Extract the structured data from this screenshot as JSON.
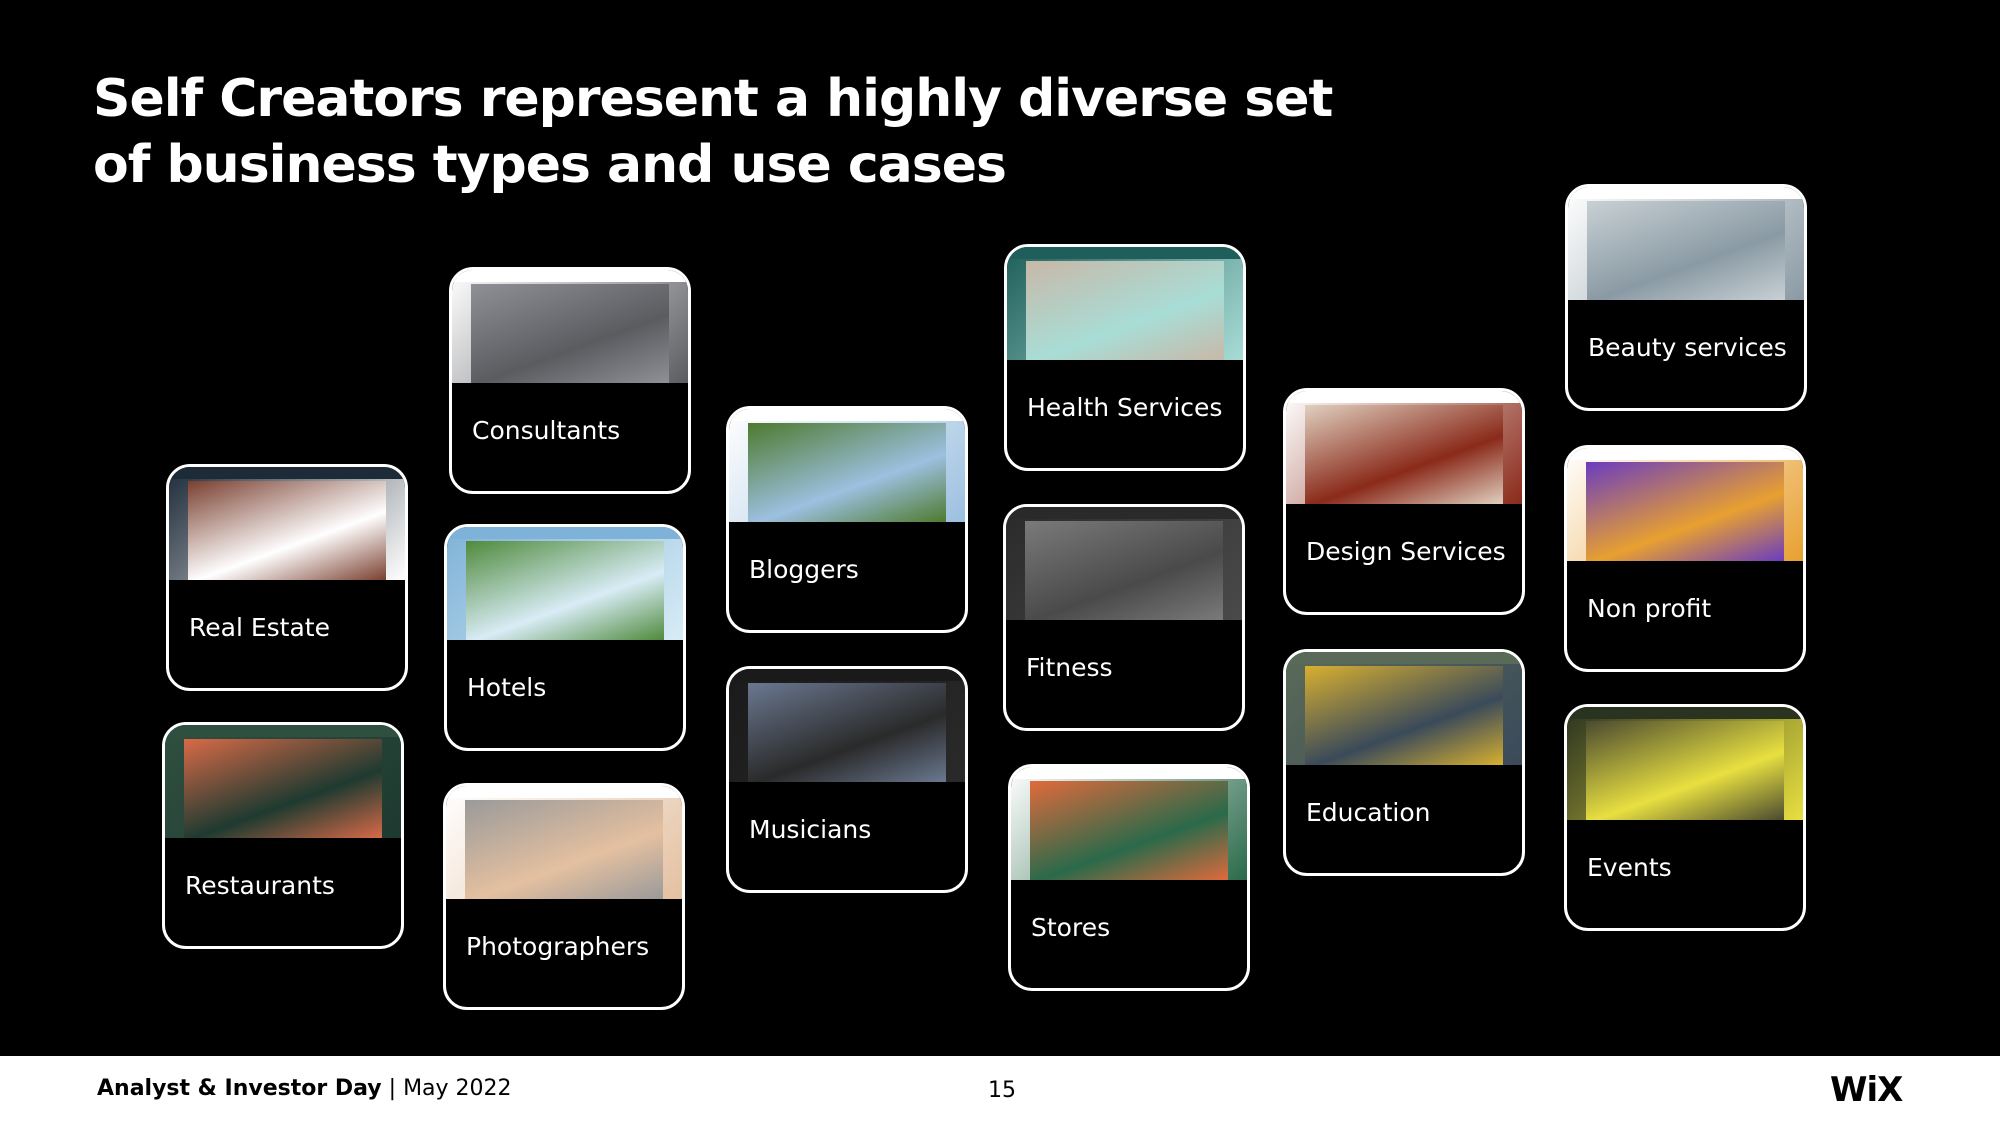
{
  "slide": {
    "title": "Self Creators represent a highly diverse set of business types and use cases"
  },
  "cards": [
    {
      "label": "Real Estate",
      "thumb_colors": [
        "#1d2a38",
        "#7a4030",
        "#ffffff"
      ]
    },
    {
      "label": "Restaurants",
      "thumb_colors": [
        "#2f4f40",
        "#d86a48",
        "#1e3a30"
      ]
    },
    {
      "label": "Consultants",
      "thumb_colors": [
        "#ffffff",
        "#8e9096",
        "#5a5c60"
      ]
    },
    {
      "label": "Hotels",
      "thumb_colors": [
        "#7fb2d8",
        "#4f8a3c",
        "#d8ecf6"
      ]
    },
    {
      "label": "Photographers",
      "thumb_colors": [
        "#ffffff",
        "#9a9a9a",
        "#e4c0a0"
      ]
    },
    {
      "label": "Bloggers",
      "thumb_colors": [
        "#ffffff",
        "#4e7a2e",
        "#9cc0e0"
      ]
    },
    {
      "label": "Musicians",
      "thumb_colors": [
        "#1a1a1a",
        "#6a7890",
        "#2a2a2a"
      ]
    },
    {
      "label": "Health Services",
      "thumb_colors": [
        "#1f5e5a",
        "#c8b8a8",
        "#a8ddd6"
      ]
    },
    {
      "label": "Fitness",
      "thumb_colors": [
        "#2a2a2a",
        "#7a7a7a",
        "#4a4a4a"
      ]
    },
    {
      "label": "Stores",
      "thumb_colors": [
        "#ffffff",
        "#e06a3c",
        "#2a6a4a"
      ]
    },
    {
      "label": "Design Services",
      "thumb_colors": [
        "#ffffff",
        "#e0d0c0",
        "#8a2a1a"
      ]
    },
    {
      "label": "Education",
      "thumb_colors": [
        "#5a6a58",
        "#d8b030",
        "#3a4a5a"
      ]
    },
    {
      "label": "Beauty services",
      "thumb_colors": [
        "#ffffff",
        "#c8d0d4",
        "#8a9aa4"
      ]
    },
    {
      "label": "Non profit",
      "thumb_colors": [
        "#ffffff",
        "#6a3cc0",
        "#e8a030"
      ]
    },
    {
      "label": "Events",
      "thumb_colors": [
        "#2a3220",
        "#4a4a30",
        "#e8e040"
      ]
    }
  ],
  "footer": {
    "event": "Analyst & Investor Day",
    "separator": "|",
    "date": "May 2022",
    "page_number": "15",
    "logo": "WiX"
  }
}
